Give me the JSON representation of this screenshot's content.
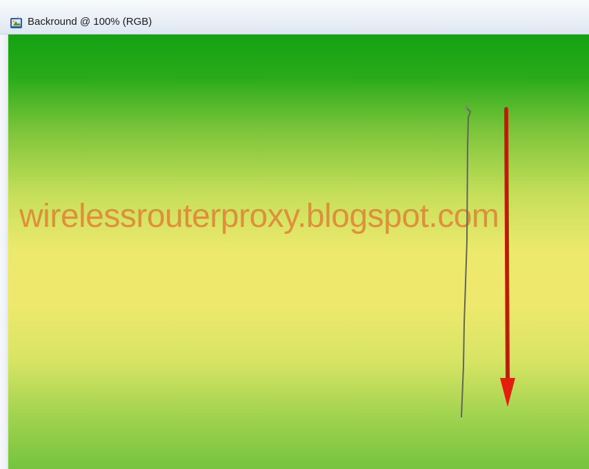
{
  "document": {
    "title": "Backround @ 100% (RGB)",
    "icon": "photoshop-document-icon"
  },
  "canvas": {
    "watermark_text": "wirelessrouterproxy.blogspot.com",
    "gradient_colors": [
      "#14a114",
      "#7cc43a",
      "#ede96d",
      "#a4d451",
      "#75c33e"
    ],
    "annotation_color": "#c4200c",
    "watermark_color": "#de8a38"
  }
}
